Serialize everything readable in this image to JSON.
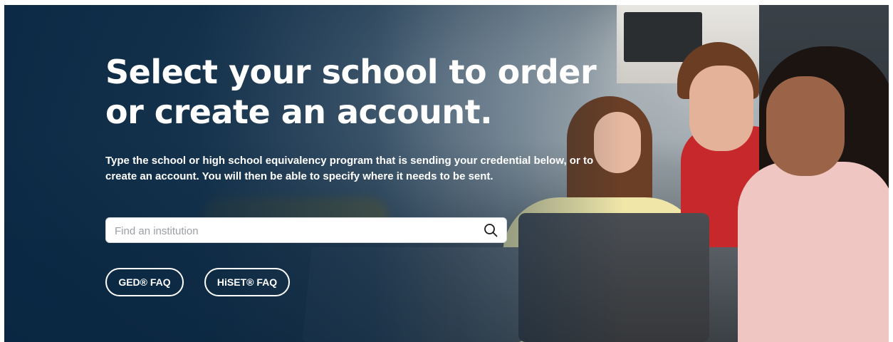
{
  "hero": {
    "title": "Select your school to order or create an account.",
    "subtitle": "Type the school or high school equivalency program that is sending your credential below, or to create an account. You will then be able to specify where it needs to be sent."
  },
  "search": {
    "placeholder": "Find an institution",
    "value": "",
    "icon": "search-icon"
  },
  "buttons": {
    "ged_faq": "GED® FAQ",
    "hiset_faq": "HiSET® FAQ"
  },
  "colors": {
    "overlay": "#07264a",
    "text": "#ffffff",
    "input_bg": "#ffffff"
  }
}
